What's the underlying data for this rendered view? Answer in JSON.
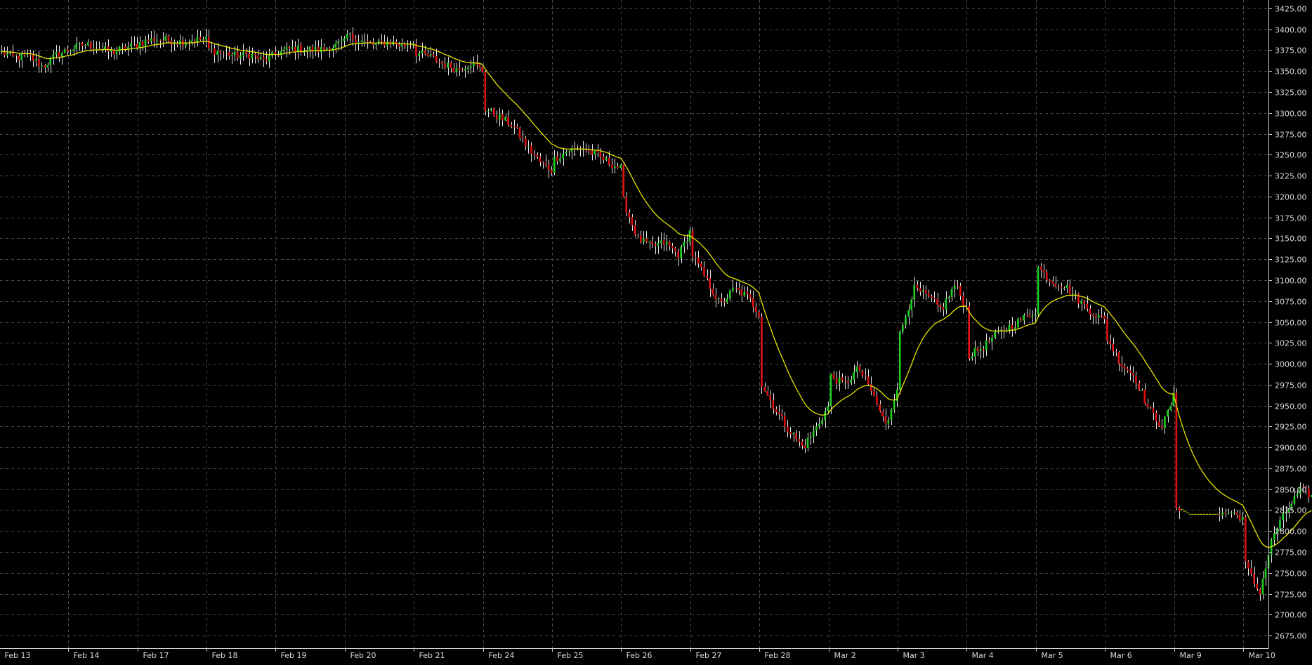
{
  "chart_data": {
    "type": "candlestick",
    "title": "",
    "xlabel": "",
    "ylabel": "",
    "ylim": [
      2660,
      3435
    ],
    "y_ticks": [
      2675,
      2700,
      2725,
      2750,
      2775,
      2800,
      2825,
      2850,
      2875,
      2900,
      2925,
      2950,
      2975,
      3000,
      3025,
      3050,
      3075,
      3100,
      3125,
      3150,
      3175,
      3200,
      3225,
      3250,
      3275,
      3300,
      3325,
      3350,
      3375,
      3400,
      3425
    ],
    "y_tick_labels": [
      "2675.00",
      "2700.00",
      "2725.00",
      "2750.00",
      "2775.00",
      "2800.00",
      "2825.00",
      "2850.00",
      "2875.00",
      "2900.00",
      "2925.00",
      "2950.00",
      "2975.00",
      "3000.00",
      "3025.00",
      "3050.00",
      "3075.00",
      "3100.00",
      "3125.00",
      "3150.00",
      "3175.00",
      "3200.00",
      "3225.00",
      "3250.00",
      "3275.00",
      "3300.00",
      "3325.00",
      "3350.00",
      "3375.00",
      "3400.00",
      "3425.00"
    ],
    "x_labels": [
      "Feb 13",
      "Feb 14",
      "Feb 17",
      "Feb 18",
      "Feb 19",
      "Feb 20",
      "Feb 21",
      "Feb 24",
      "Feb 25",
      "Feb 26",
      "Feb 27",
      "Feb 28",
      "Mar 2",
      "Mar 3",
      "Mar 4",
      "Mar 5",
      "Mar 6",
      "Mar 9",
      "Mar 10"
    ],
    "grid": true,
    "colors": {
      "background": "#000000",
      "grid": "#4a4a4a",
      "axis": "#cfcfcf",
      "bull": "#1fd01f",
      "bear": "#e01010",
      "wick": "#e8e8e8",
      "moving_average": "#e6e600",
      "gap_line": "#e6e600"
    },
    "daily_path": [
      {
        "date": "Feb 13",
        "v": [
          3372,
          3366,
          3368,
          3355,
          3370,
          3376
        ]
      },
      {
        "date": "Feb 14",
        "v": [
          3376,
          3382,
          3378,
          3372,
          3378,
          3382
        ]
      },
      {
        "date": "Feb 17",
        "v": [
          3384,
          3388,
          3387,
          3385,
          3388,
          3387
        ]
      },
      {
        "date": "Feb 18",
        "v": [
          3376,
          3372,
          3368,
          3370,
          3362,
          3372
        ]
      },
      {
        "date": "Feb 19",
        "v": [
          3372,
          3377,
          3376,
          3375,
          3380,
          3385
        ]
      },
      {
        "date": "Feb 20",
        "v": [
          3393,
          3386,
          3381,
          3385,
          3380,
          3385
        ]
      },
      {
        "date": "Feb 21",
        "v": [
          3372,
          3367,
          3358,
          3352,
          3360,
          3348
        ]
      },
      {
        "date": "Feb 24",
        "v": [
          3305,
          3295,
          3285,
          3260,
          3240,
          3230
        ]
      },
      {
        "date": "Feb 25",
        "v": [
          3245,
          3255,
          3258,
          3250,
          3240,
          3232
        ]
      },
      {
        "date": "Feb 26",
        "v": [
          3195,
          3150,
          3140,
          3145,
          3130,
          3165
        ]
      },
      {
        "date": "Feb 27",
        "v": [
          3130,
          3100,
          3070,
          3090,
          3080,
          3055
        ]
      },
      {
        "date": "Feb 28",
        "v": [
          2975,
          2945,
          2920,
          2900,
          2925,
          2955
        ]
      },
      {
        "date": "Mar 2",
        "v": [
          2985,
          2975,
          2995,
          2965,
          2925,
          2985
        ]
      },
      {
        "date": "Mar 3",
        "v": [
          3035,
          3090,
          3080,
          3065,
          3095,
          3060
        ]
      },
      {
        "date": "Mar 4",
        "v": [
          3010,
          3020,
          3035,
          3045,
          3055,
          3065
        ]
      },
      {
        "date": "Mar 5",
        "v": [
          3115,
          3098,
          3092,
          3075,
          3060,
          3050
        ]
      },
      {
        "date": "Mar 6",
        "v": [
          3030,
          3000,
          2985,
          2945,
          2925,
          2970
        ]
      },
      {
        "date": "Mar 9",
        "v": [
          2830,
          2820,
          2820,
          2820,
          2822,
          2815
        ]
      },
      {
        "date": "Mar 10",
        "v": [
          2760,
          2725,
          2795,
          2825,
          2850,
          2840
        ]
      }
    ]
  }
}
